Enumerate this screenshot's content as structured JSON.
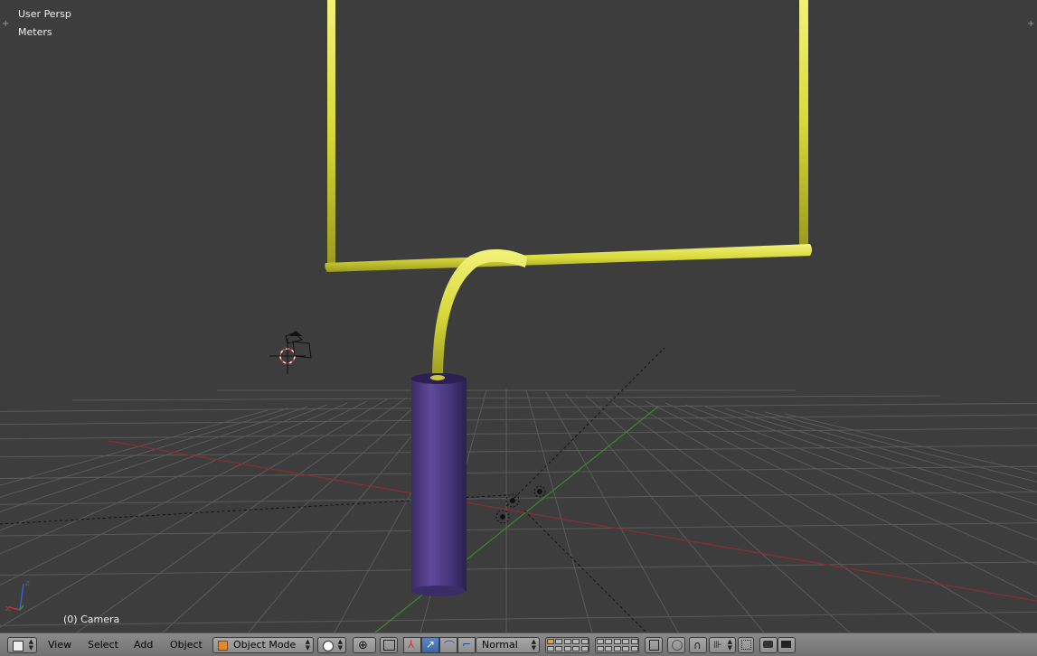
{
  "viewport": {
    "view_name": "User Persp",
    "units": "Meters",
    "selected_object": "(0) Camera",
    "colors": {
      "background": "#3d3d3d",
      "post": "#e3e33a",
      "pad": "#4a3a7a",
      "x_axis": "#8a2d2d",
      "y_axis": "#3a8a2a",
      "grid": "#5e5e5e"
    }
  },
  "header": {
    "editor_icon": "cube-icon",
    "menus": {
      "view": "View",
      "select": "Select",
      "add": "Add",
      "object": "Object"
    },
    "mode": "Object Mode",
    "pivot_icon": "pivot-point-icon",
    "orientation": "Normal",
    "layer_count": 20
  }
}
